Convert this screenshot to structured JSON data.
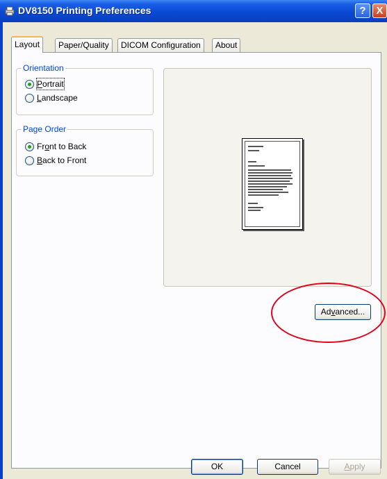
{
  "window": {
    "title": "DV8150 Printing Preferences",
    "help_glyph": "?",
    "close_glyph": "X",
    "icon": "printer-icon"
  },
  "tabs": [
    {
      "label": "Layout",
      "active": true
    },
    {
      "label": "Paper/Quality",
      "active": false
    },
    {
      "label": "DICOM Configuration",
      "active": false
    },
    {
      "label": "About",
      "active": false
    }
  ],
  "orientation": {
    "legend": "Orientation",
    "options": [
      {
        "label": "Portrait",
        "checked": true
      },
      {
        "label": "Landscape",
        "checked": false
      }
    ]
  },
  "page_order": {
    "legend": "Page Order",
    "options": [
      {
        "label": "Front to Back",
        "checked": true
      },
      {
        "label": "Back to Front",
        "checked": false
      }
    ]
  },
  "preview": {
    "icon": "portrait-page-preview-icon"
  },
  "buttons": {
    "advanced": "Advanced...",
    "ok": "OK",
    "cancel": "Cancel",
    "apply": "Apply"
  },
  "colors": {
    "title_bar": "#0a49d4",
    "group_legend": "#0046d5",
    "annotation_circle": "#e2001a",
    "radio_dot": "#21a121"
  }
}
